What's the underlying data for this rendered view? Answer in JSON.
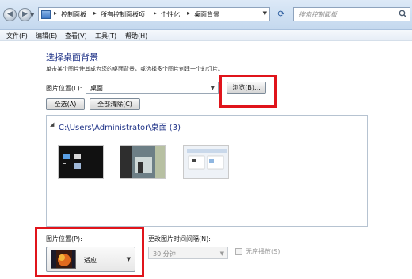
{
  "breadcrumb": [
    "控制面板",
    "所有控制面板项",
    "个性化",
    "桌面背景"
  ],
  "search": {
    "placeholder": "搜索控制面板"
  },
  "menu": [
    "文件(F)",
    "编辑(E)",
    "查看(V)",
    "工具(T)",
    "帮助(H)"
  ],
  "page": {
    "title": "选择桌面背景",
    "description": "单击某个图片使其成为您的桌面背景，或选择多个图片创建一个幻灯片。"
  },
  "location": {
    "label": "图片位置(L):",
    "value": "桌面",
    "browse_label": "浏览(B)..."
  },
  "buttons": {
    "select_all": "全选(A)",
    "clear_all": "全部清除(C)"
  },
  "gallery": {
    "title": "C:\\Users\\Administrator\\桌面 (3)"
  },
  "position": {
    "label": "图片位置(P):",
    "value": "适应"
  },
  "interval": {
    "label": "更改图片时间间隔(N):",
    "value": "30 分钟"
  },
  "shuffle": {
    "label": "无序播放(S)"
  },
  "colors": {
    "highlight": "#e0141b",
    "title": "#1e3287"
  }
}
